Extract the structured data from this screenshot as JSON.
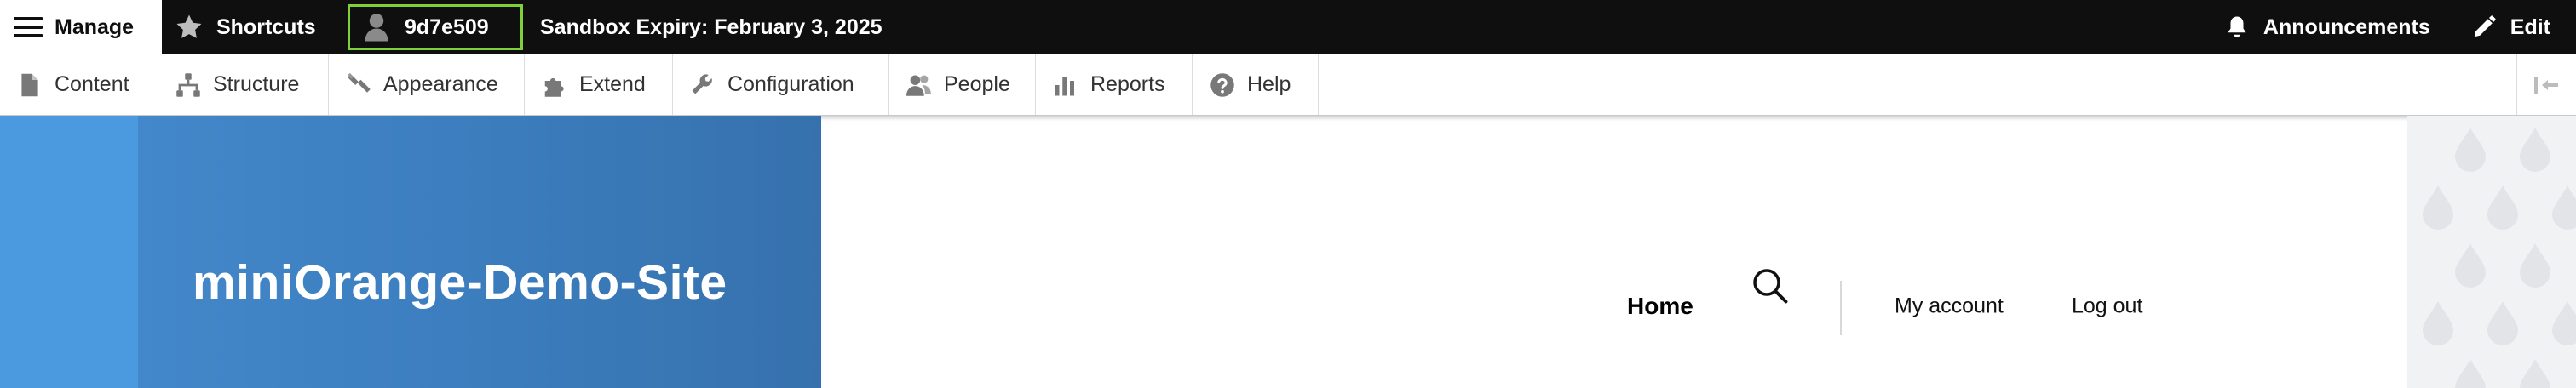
{
  "toolbar": {
    "manage_label": "Manage",
    "shortcuts_label": "Shortcuts",
    "user_label": "9d7e509",
    "expiry_text": "Sandbox Expiry: February 3, 2025",
    "announcements_label": "Announcements",
    "edit_label": "Edit",
    "user_box_border_color": "#7fd137"
  },
  "tray": {
    "items": [
      {
        "label": "Content",
        "icon": "file-icon"
      },
      {
        "label": "Structure",
        "icon": "sitemap-icon"
      },
      {
        "label": "Appearance",
        "icon": "paintbrush-icon"
      },
      {
        "label": "Extend",
        "icon": "puzzle-icon"
      },
      {
        "label": "Configuration",
        "icon": "wrench-icon"
      },
      {
        "label": "People",
        "icon": "people-icon"
      },
      {
        "label": "Reports",
        "icon": "bar-chart-icon"
      },
      {
        "label": "Help",
        "icon": "help-icon"
      }
    ],
    "toggle_icon": "collapse-left-icon"
  },
  "header": {
    "site_name": "miniOrange-Demo-Site",
    "nav": {
      "home_label": "Home"
    },
    "account": {
      "my_account_label": "My account",
      "logout_label": "Log out"
    },
    "brand_color": "#3c7ebf"
  }
}
